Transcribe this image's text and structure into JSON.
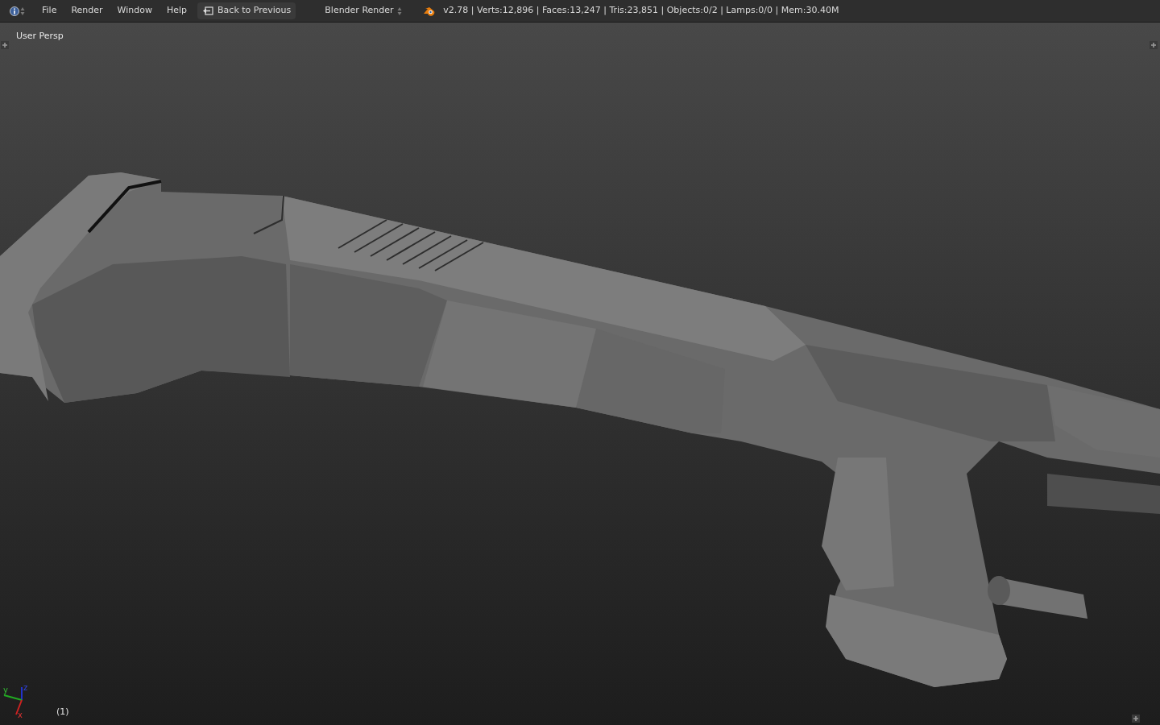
{
  "header": {
    "menus": [
      "File",
      "Render",
      "Window",
      "Help"
    ],
    "back_button": "Back to Previous",
    "render_engine": "Blender Render",
    "stats": "v2.78 | Verts:12,896 | Faces:13,247 | Tris:23,851 | Objects:0/2 | Lamps:0/0 | Mem:30.40M"
  },
  "viewport": {
    "view_label": "User Persp",
    "frame_label": "(1)",
    "axes": [
      "z",
      "y",
      "x"
    ]
  }
}
